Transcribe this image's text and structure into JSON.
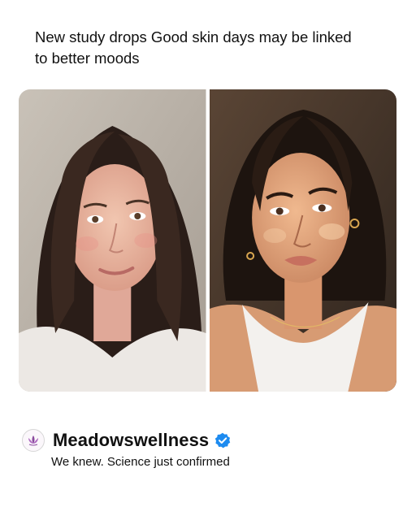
{
  "post": {
    "headline": "New study drops Good skin days may be linked to better moods"
  },
  "images": {
    "left": "natural-bare-face-selfie-photo",
    "right": "glowing-golden-hour-selfie-photo"
  },
  "account": {
    "name": "Meadowswellness",
    "avatar_icon": "lotus-logo-icon",
    "verified_icon": "verified-badge-icon",
    "caption": "We knew. Science just confirmed"
  },
  "colors": {
    "text": "#111111",
    "verified_blue": "#1d8bf0",
    "brand_purple": "#8a4a9e"
  }
}
